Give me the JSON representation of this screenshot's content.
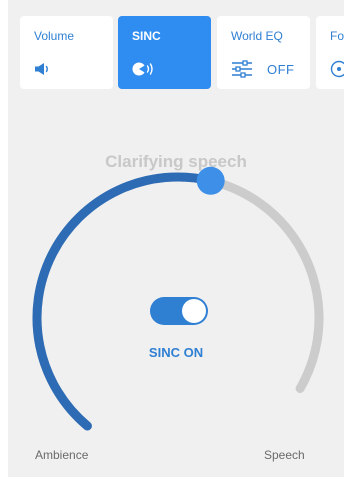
{
  "tabs": [
    {
      "label": "Volume",
      "icon": "speaker-icon",
      "value": ""
    },
    {
      "label": "SINC",
      "icon": "sinc-icon",
      "value": ""
    },
    {
      "label": "World EQ",
      "icon": "equalizer-sliders-icon",
      "value": "OFF"
    },
    {
      "label": "Fo",
      "icon": "focus-icon",
      "value": ""
    }
  ],
  "active_tab": "SINC",
  "mode_title": "Clarifying speech",
  "balance_slider": {
    "level_percent": 59,
    "left_label": "Ambience",
    "right_label": "Speech"
  },
  "sinc_toggle": {
    "on": true,
    "label": "SINC ON"
  },
  "colors": {
    "accent": "#2f8cf0",
    "arc_active": "#2d6bb5",
    "arc_inactive": "#cccccc",
    "tab_text": "#2f7fd3",
    "background": "#f0f0f0"
  }
}
